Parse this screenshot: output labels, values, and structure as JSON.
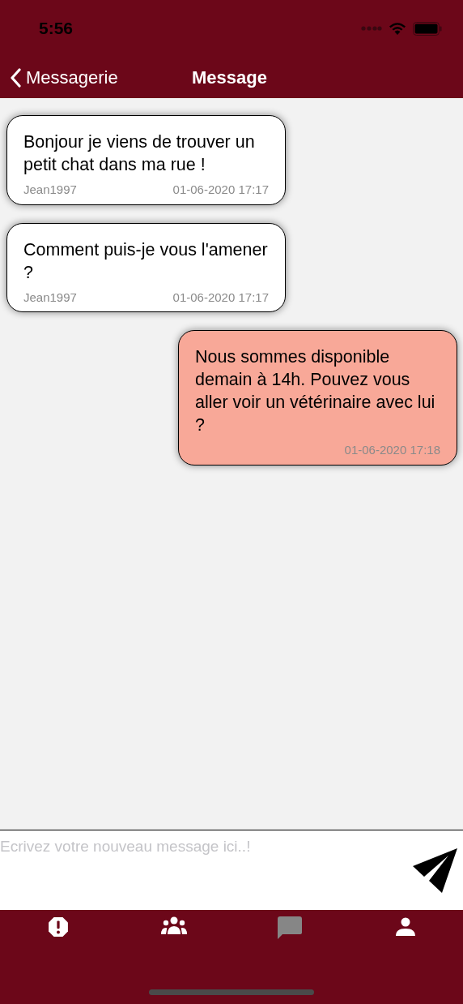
{
  "status_bar": {
    "time": "5:56"
  },
  "nav": {
    "back": "Messagerie",
    "title": "Message"
  },
  "messages": [
    {
      "kind": "incoming",
      "text": "Bonjour je viens de trouver un petit chat dans ma rue !",
      "author": "Jean1997",
      "time": "01-06-2020 17:17"
    },
    {
      "kind": "incoming",
      "text": "Comment puis-je vous l'amener ?",
      "author": "Jean1997",
      "time": "01-06-2020 17:17"
    },
    {
      "kind": "outgoing",
      "text": "Nous sommes disponible demain à 14h. Pouvez vous aller voir un vétérinaire avec lui ?",
      "time": "01-06-2020 17:18"
    }
  ],
  "composer": {
    "placeholder": "Ecrivez votre nouveau message ici..!"
  },
  "tabs": [
    {
      "kind": "alert",
      "selected": false
    },
    {
      "kind": "group",
      "selected": false
    },
    {
      "kind": "chat",
      "selected": true
    },
    {
      "kind": "person",
      "selected": false
    }
  ]
}
